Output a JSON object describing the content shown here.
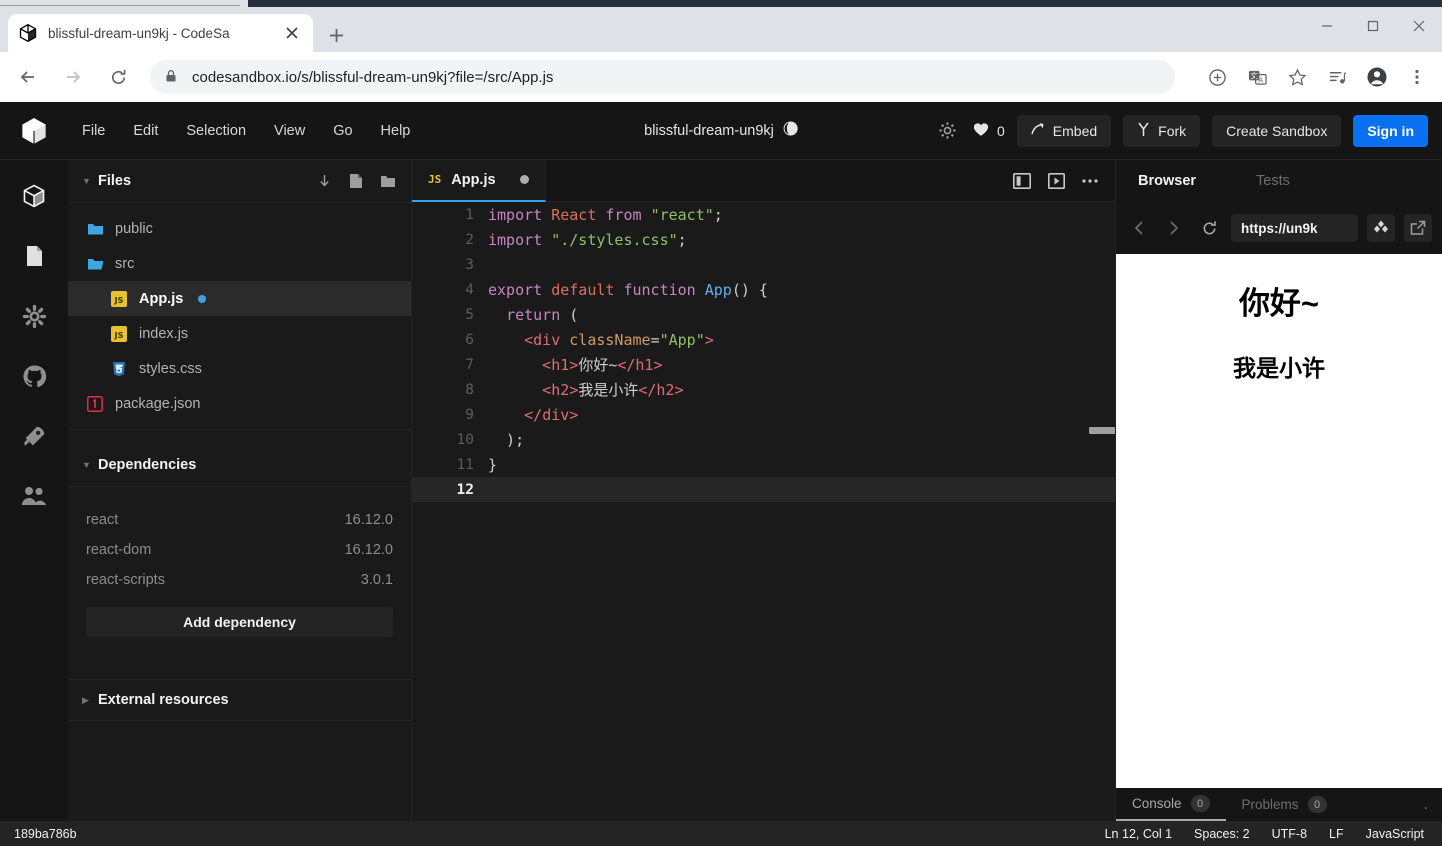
{
  "browser": {
    "tab": {
      "title": "blissful-dream-un9kj - CodeSa",
      "favicon": "codesandbox-cube-icon",
      "close": "close-icon"
    },
    "new_tab_label": "+",
    "window_controls": {
      "minimize": "minimize-icon",
      "maximize": "maximize-icon",
      "close": "close-icon"
    },
    "nav": {
      "back": "back-arrow-icon",
      "forward": "forward-arrow-icon",
      "reload": "reload-icon"
    },
    "omnibox": {
      "lock": "lock-icon",
      "url": "codesandbox.io/s/blissful-dream-un9kj?file=/src/App.js"
    },
    "toolbar_icons": [
      "install-app-icon",
      "translate-icon",
      "bookmark-star-icon",
      "reading-list-icon",
      "profile-avatar-icon",
      "chrome-menu-icon"
    ]
  },
  "header": {
    "logo": "codesandbox-logo",
    "menus": [
      "File",
      "Edit",
      "Selection",
      "View",
      "Go",
      "Help"
    ],
    "sandbox_title": "blissful-dream-un9kj",
    "privacy_icon": "globe-icon",
    "settings_icon": "gear-icon",
    "likes": {
      "icon": "heart-icon",
      "count": "0"
    },
    "embed_label": "Embed",
    "fork_label": "Fork",
    "create_sandbox_label": "Create Sandbox",
    "signin_label": "Sign in"
  },
  "rail": [
    {
      "name": "files-icon",
      "active": true
    },
    {
      "name": "file-document-icon",
      "active": false
    },
    {
      "name": "gear-icon",
      "active": false
    },
    {
      "name": "github-icon",
      "active": false
    },
    {
      "name": "rocket-deploy-icon",
      "active": false
    },
    {
      "name": "live-people-icon",
      "active": false
    }
  ],
  "explorer": {
    "files_title": "Files",
    "head_icons": [
      "download-icon",
      "new-file-icon",
      "new-folder-icon"
    ],
    "tree": [
      {
        "name": "public",
        "type": "folder",
        "depth": 0,
        "active": false,
        "dirty": false
      },
      {
        "name": "src",
        "type": "folder-open",
        "depth": 0,
        "active": false,
        "dirty": false
      },
      {
        "name": "App.js",
        "type": "js",
        "depth": 1,
        "active": true,
        "dirty": true
      },
      {
        "name": "index.js",
        "type": "js",
        "depth": 1,
        "active": false,
        "dirty": false
      },
      {
        "name": "styles.css",
        "type": "css",
        "depth": 1,
        "active": false,
        "dirty": false
      },
      {
        "name": "package.json",
        "type": "json",
        "depth": 0,
        "active": false,
        "dirty": false
      }
    ],
    "dependencies_title": "Dependencies",
    "dependencies": [
      {
        "name": "react",
        "version": "16.12.0"
      },
      {
        "name": "react-dom",
        "version": "16.12.0"
      },
      {
        "name": "react-scripts",
        "version": "3.0.1"
      }
    ],
    "add_dependency_label": "Add dependency",
    "external_resources_title": "External resources"
  },
  "editor": {
    "tab": {
      "label": "App.js",
      "badge": "JS",
      "dirty": true
    },
    "tab_icons": [
      "split-pane-icon",
      "preview-icon",
      "more-options-icon"
    ],
    "lines": [
      {
        "n": "1",
        "tokens": [
          {
            "t": "import",
            "c": "k"
          },
          {
            "t": " ",
            "c": "pun"
          },
          {
            "t": "React",
            "c": "kr"
          },
          {
            "t": " ",
            "c": "pun"
          },
          {
            "t": "from",
            "c": "k"
          },
          {
            "t": " ",
            "c": "pun"
          },
          {
            "t": "\"react\"",
            "c": "str"
          },
          {
            "t": ";",
            "c": "pun"
          }
        ]
      },
      {
        "n": "2",
        "tokens": [
          {
            "t": "import",
            "c": "k"
          },
          {
            "t": " ",
            "c": "pun"
          },
          {
            "t": "\"./styles.css\"",
            "c": "str"
          },
          {
            "t": ";",
            "c": "pun"
          }
        ]
      },
      {
        "n": "3",
        "tokens": []
      },
      {
        "n": "4",
        "tokens": [
          {
            "t": "export",
            "c": "k"
          },
          {
            "t": " ",
            "c": "pun"
          },
          {
            "t": "default",
            "c": "kr"
          },
          {
            "t": " ",
            "c": "pun"
          },
          {
            "t": "function",
            "c": "k"
          },
          {
            "t": " ",
            "c": "pun"
          },
          {
            "t": "App",
            "c": "fn"
          },
          {
            "t": "() {",
            "c": "pun"
          }
        ]
      },
      {
        "n": "5",
        "tokens": [
          {
            "t": "  ",
            "c": "pun"
          },
          {
            "t": "return",
            "c": "k"
          },
          {
            "t": " (",
            "c": "pun"
          }
        ]
      },
      {
        "n": "6",
        "tokens": [
          {
            "t": "    <",
            "c": "tag"
          },
          {
            "t": "div",
            "c": "tag"
          },
          {
            "t": " ",
            "c": "pun"
          },
          {
            "t": "className",
            "c": "attr"
          },
          {
            "t": "=",
            "c": "pun"
          },
          {
            "t": "\"App\"",
            "c": "str"
          },
          {
            "t": ">",
            "c": "tag"
          }
        ]
      },
      {
        "n": "7",
        "tokens": [
          {
            "t": "      <",
            "c": "tag"
          },
          {
            "t": "h1",
            "c": "tag"
          },
          {
            "t": ">",
            "c": "tag"
          },
          {
            "t": "你好~",
            "c": "pun"
          },
          {
            "t": "</",
            "c": "tag"
          },
          {
            "t": "h1",
            "c": "tag"
          },
          {
            "t": ">",
            "c": "tag"
          }
        ]
      },
      {
        "n": "8",
        "tokens": [
          {
            "t": "      <",
            "c": "tag"
          },
          {
            "t": "h2",
            "c": "tag"
          },
          {
            "t": ">",
            "c": "tag"
          },
          {
            "t": "我是小许",
            "c": "pun"
          },
          {
            "t": "</",
            "c": "tag"
          },
          {
            "t": "h2",
            "c": "tag"
          },
          {
            "t": ">",
            "c": "tag"
          }
        ]
      },
      {
        "n": "9",
        "tokens": [
          {
            "t": "    </",
            "c": "tag"
          },
          {
            "t": "div",
            "c": "tag"
          },
          {
            "t": ">",
            "c": "tag"
          }
        ]
      },
      {
        "n": "10",
        "tokens": [
          {
            "t": "  );",
            "c": "pun"
          }
        ]
      },
      {
        "n": "11",
        "tokens": [
          {
            "t": "}",
            "c": "pun"
          }
        ]
      },
      {
        "n": "12",
        "tokens": [],
        "active": true
      }
    ]
  },
  "preview": {
    "tabs": [
      {
        "label": "Browser",
        "active": true
      },
      {
        "label": "Tests",
        "active": false
      }
    ],
    "nav_icons": [
      "preview-back-icon",
      "preview-forward-icon",
      "preview-reload-icon"
    ],
    "url": "https://un9k",
    "responsive_icon": "responsive-mode-icon",
    "external_icon": "open-external-icon",
    "rendered": {
      "h1": "你好~",
      "h2": "我是小许"
    },
    "console": {
      "tabs": [
        {
          "label": "Console",
          "badge": "0",
          "active": true
        },
        {
          "label": "Problems",
          "badge": "0",
          "active": false
        }
      ],
      "more": "."
    }
  },
  "status_bar": {
    "commit_hash": "189ba786b",
    "items": [
      "Ln 12, Col 1",
      "Spaces: 2",
      "UTF-8",
      "LF",
      "JavaScript"
    ]
  },
  "colors": {
    "accent_blue": "#0971f1",
    "dirty_dot": "#3ca0e7",
    "app_bg": "#1a1a1a",
    "panel_bg": "#151515"
  }
}
